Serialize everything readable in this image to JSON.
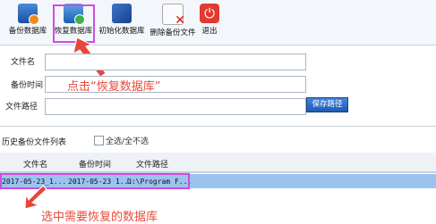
{
  "toolbar": {
    "backup_label": "备份数据库",
    "restore_label": "恢复数据库",
    "init_label": "初始化数据库",
    "delete_label": "删除备份文件",
    "exit_label": "退出"
  },
  "form": {
    "filename_label": "文件名",
    "backup_time_label": "备份时间",
    "file_path_label": "文件路径",
    "save_path_button": "保存路径",
    "filename_value": "",
    "backup_time_value": "",
    "file_path_value": ""
  },
  "annotations": {
    "click_restore": "点击“恢复数据库”",
    "select_db": "选中需要恢复的数据库"
  },
  "history": {
    "title": "历史备份文件列表",
    "select_all_label": "全选/全不选",
    "columns": [
      "文件名",
      "备份时间",
      "文件路径"
    ],
    "rows": [
      {
        "filename": "2017-05-23_1...",
        "backup_time": "2017-05-23 1...",
        "file_path": "D:\\Program F..."
      }
    ]
  },
  "colors": {
    "accent": "#1f5ab4",
    "highlight_box": "#d04be0",
    "annotation": "#e74b3c",
    "selected_row": "#9cc3ef"
  }
}
